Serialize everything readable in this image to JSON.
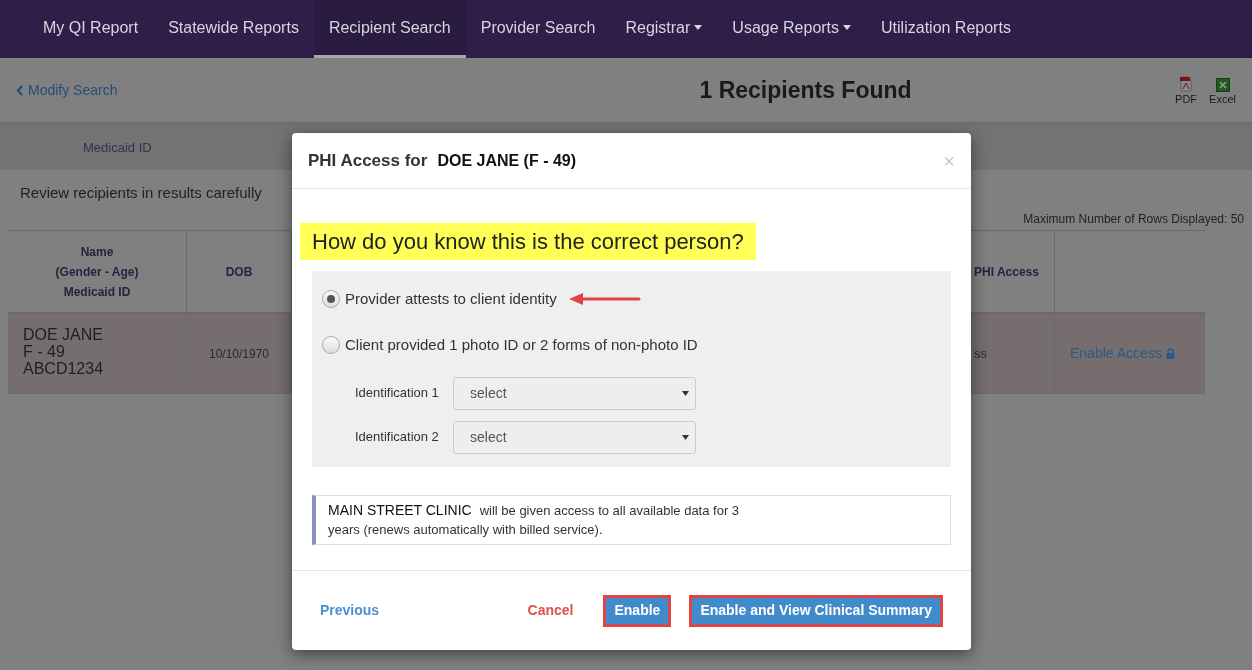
{
  "nav": {
    "items": [
      {
        "label": "My QI Report",
        "selected": false,
        "dropdown": false
      },
      {
        "label": "Statewide Reports",
        "selected": false,
        "dropdown": false
      },
      {
        "label": "Recipient Search",
        "selected": true,
        "dropdown": false
      },
      {
        "label": "Provider Search",
        "selected": false,
        "dropdown": false
      },
      {
        "label": "Registrar",
        "selected": false,
        "dropdown": true
      },
      {
        "label": "Usage Reports",
        "selected": false,
        "dropdown": true
      },
      {
        "label": "Utilization Reports",
        "selected": false,
        "dropdown": false
      }
    ]
  },
  "toolbar": {
    "back_link": "Modify Search",
    "title": "1 Recipients Found",
    "exports": [
      {
        "label": "PDF",
        "kind": "pdf"
      },
      {
        "label": "Excel",
        "kind": "excel"
      }
    ]
  },
  "filter_bar": {
    "label": "Medicaid ID"
  },
  "notice": "Review recipients in results carefully",
  "max_rows": "Maximum Number of Rows Displayed: 50",
  "table": {
    "columns": [
      {
        "lines": [
          "Name",
          "(Gender - Age)",
          "Medicaid ID"
        ]
      },
      {
        "lines": [
          "DOB"
        ]
      },
      {
        "lines": [
          "PHI Access"
        ]
      }
    ],
    "rows": [
      {
        "name_lines": [
          "DOE JANE",
          "F - 49",
          "ABCD1234"
        ],
        "dob": "10/10/1970",
        "phi_access": "ss",
        "action": "Enable Access"
      }
    ]
  },
  "modal": {
    "title_prefix": "PHI Access for",
    "title_name": "DOE JANE (F - 49)",
    "close": "×",
    "question": "How do you know this is the correct person?",
    "options": [
      {
        "label": "Provider attests to client identity",
        "selected": true
      },
      {
        "label": "Client provided 1 photo ID or 2 forms of non-photo ID",
        "selected": false
      }
    ],
    "id_fields": [
      {
        "label": "Identification 1",
        "value": "select"
      },
      {
        "label": "Identification 2",
        "value": "select"
      }
    ],
    "info": {
      "clinic": "MAIN STREET CLINIC",
      "text": "will be given access to all available data for 3 years (renews automatically with billed service)."
    },
    "footer": {
      "previous": "Previous",
      "cancel": "Cancel",
      "buttons": [
        {
          "label": "Enable",
          "highlighted": true
        },
        {
          "label": "Enable and View Clinical Summary",
          "highlighted": true
        }
      ]
    }
  }
}
